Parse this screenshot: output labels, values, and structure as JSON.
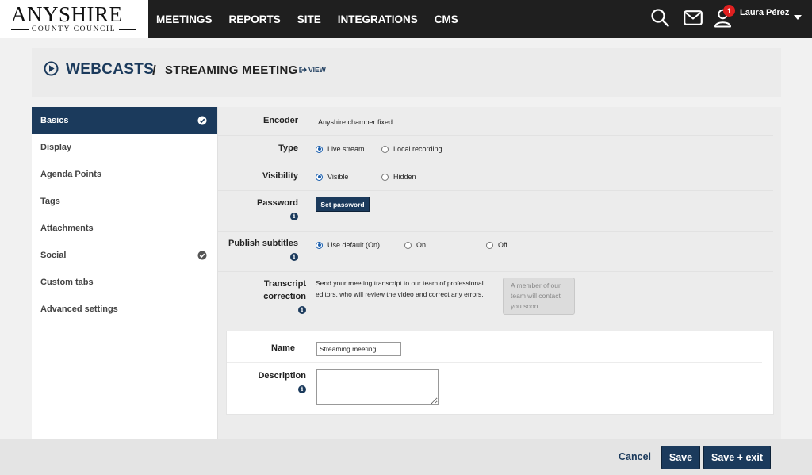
{
  "brand": {
    "name": "ANYSHIRE",
    "subtitle": "COUNTY COUNCIL"
  },
  "nav": {
    "items": [
      {
        "id": "meetings",
        "label": "MEETINGS"
      },
      {
        "id": "reports",
        "label": "REPORTS"
      },
      {
        "id": "site",
        "label": "SITE"
      },
      {
        "id": "integrations",
        "label": "INTEGRATIONS"
      },
      {
        "id": "cms",
        "label": "CMS"
      }
    ]
  },
  "user": {
    "name": "Laura Pérez",
    "notification_count": "1"
  },
  "header": {
    "section": "WEBCASTS",
    "separator": "/",
    "title": "STREAMING MEETING",
    "view_label": "VIEW"
  },
  "sidebar": {
    "items": [
      {
        "id": "basics",
        "label": "Basics",
        "active": true,
        "checked": true
      },
      {
        "id": "display",
        "label": "Display"
      },
      {
        "id": "agenda-points",
        "label": "Agenda Points"
      },
      {
        "id": "tags",
        "label": "Tags"
      },
      {
        "id": "attachments",
        "label": "Attachments"
      },
      {
        "id": "social",
        "label": "Social",
        "checked": true
      },
      {
        "id": "custom-tabs",
        "label": "Custom tabs"
      },
      {
        "id": "advanced-settings",
        "label": "Advanced settings"
      }
    ]
  },
  "form": {
    "encoder": {
      "label": "Encoder",
      "value": "Anyshire chamber fixed"
    },
    "type": {
      "label": "Type",
      "options": [
        "Live stream",
        "Local recording"
      ],
      "selected": "Live stream"
    },
    "visibility": {
      "label": "Visibility",
      "options": [
        "Visible",
        "Hidden"
      ],
      "selected": "Visible"
    },
    "password": {
      "label": "Password",
      "button": "Set password"
    },
    "subtitles": {
      "label": "Publish subtitles",
      "options": [
        "Use default (On)",
        "On",
        "Off"
      ],
      "selected": "Use default (On)"
    },
    "transcript": {
      "label_line1": "Transcript",
      "label_line2": "correction",
      "text": "Send your meeting transcript to our team of professional editors, who will review the video and correct any errors.",
      "status": "A member of our team will contact you soon"
    },
    "name": {
      "label": "Name",
      "value": "Streaming meeting"
    },
    "description": {
      "label": "Description",
      "value": ""
    }
  },
  "footer": {
    "cancel": "Cancel",
    "save": "Save",
    "save_exit": "Save + exit"
  },
  "colors": {
    "accent": "#1b3a5c",
    "topbar": "#1f1f1f",
    "badge": "#e02020"
  },
  "icons": {
    "search": "search-icon",
    "mail": "mail-icon",
    "user": "user-icon",
    "play": "play-circle-icon",
    "view": "external-link-icon",
    "info": "info-icon",
    "check": "check-circle-icon"
  }
}
